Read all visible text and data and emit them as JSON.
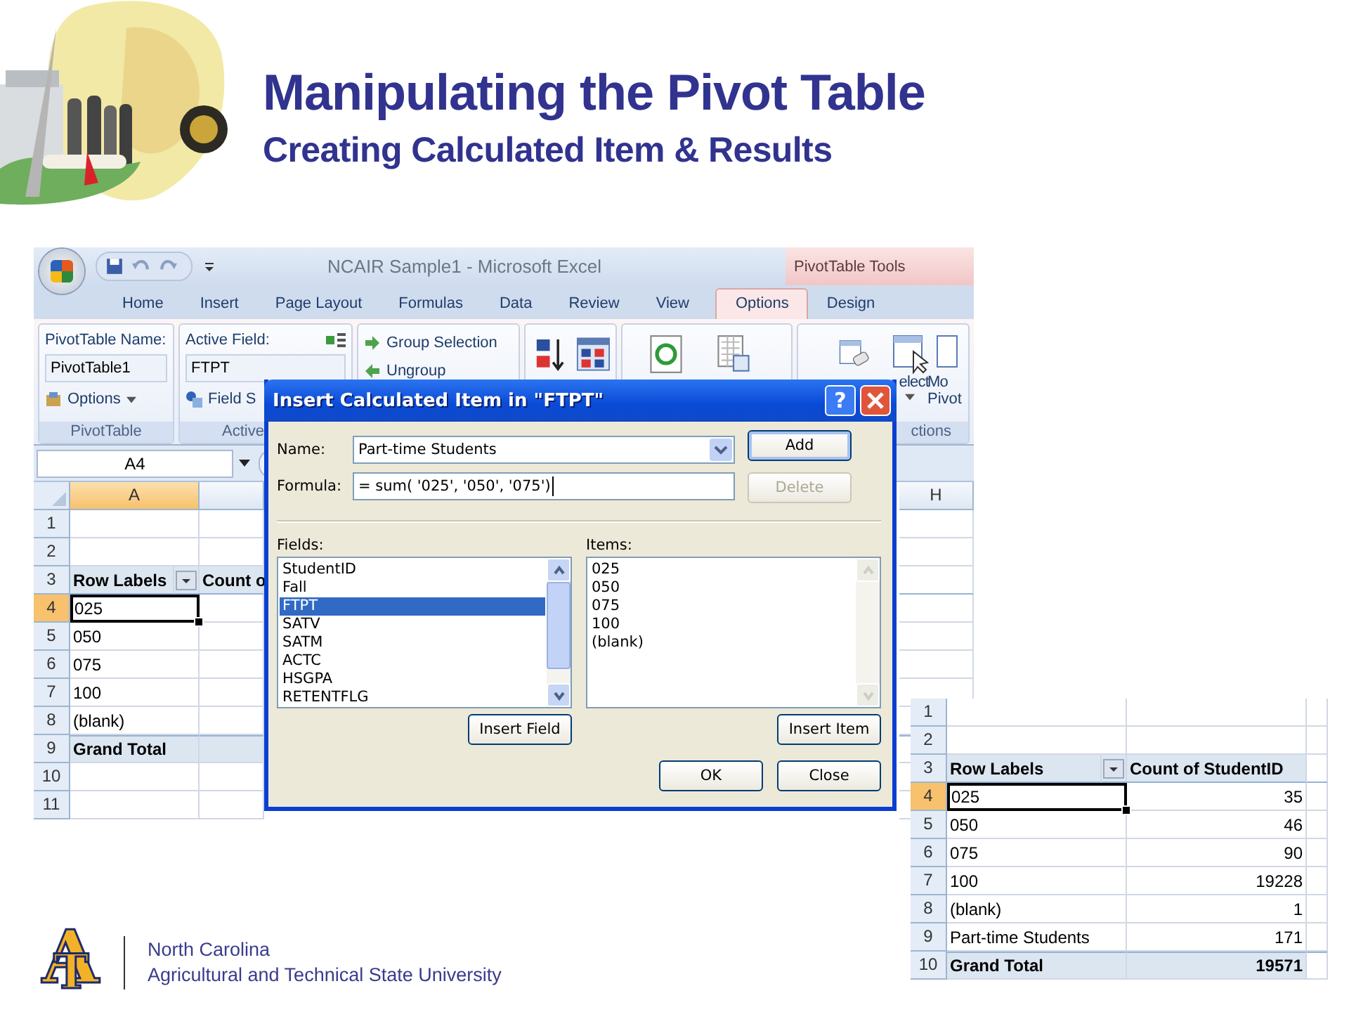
{
  "slide": {
    "title": "Manipulating the Pivot Table",
    "subtitle": "Creating Calculated Item & Results",
    "logo": {
      "letter_1": "A",
      "letter_2": "T"
    },
    "footer": [
      "North Carolina",
      "Agricultural and Technical State University"
    ]
  },
  "excel": {
    "title": "NCAIR Sample1 - Microsoft Excel",
    "contextual_tab": "PivotTable Tools",
    "tabs": [
      {
        "label": "Home",
        "selected": false
      },
      {
        "label": "Insert",
        "selected": false
      },
      {
        "label": "Page Layout",
        "selected": false
      },
      {
        "label": "Formulas",
        "selected": false
      },
      {
        "label": "Data",
        "selected": false
      },
      {
        "label": "Review",
        "selected": false
      },
      {
        "label": "View",
        "selected": false
      },
      {
        "label": "Options",
        "selected": true
      },
      {
        "label": "Design",
        "selected": false
      }
    ],
    "ribbon": {
      "pivot_name_label": "PivotTable Name:",
      "pivot_name": "PivotTable1",
      "options": "Options",
      "group_1": "PivotTable",
      "active_field_label": "Active Field:",
      "active_field": "FTPT",
      "field_settings": "Field S",
      "group_2": "Active",
      "group_selection": "Group Selection",
      "ungroup": "Ungroup",
      "select_fragment": "elect",
      "move_fragment_1": "Mo",
      "move_fragment_2": "Pivot",
      "group_6": "ctions"
    },
    "name_box": "A4",
    "columns": [
      {
        "label": "A",
        "selected": true
      },
      {
        "label": "H",
        "selected": false
      }
    ],
    "rows": [
      {
        "num": "1",
        "selected": false
      },
      {
        "num": "2",
        "selected": false
      },
      {
        "num": "3",
        "kind": "header",
        "a": "Row Labels",
        "b": "Count o",
        "selected": false
      },
      {
        "num": "4",
        "a": "025",
        "selected": true
      },
      {
        "num": "5",
        "a": "050",
        "selected": false
      },
      {
        "num": "6",
        "a": "075",
        "selected": false
      },
      {
        "num": "7",
        "a": "100",
        "selected": false
      },
      {
        "num": "8",
        "a": "(blank)",
        "selected": false
      },
      {
        "num": "9",
        "kind": "total",
        "a": "Grand Total",
        "selected": false
      },
      {
        "num": "10",
        "selected": false
      },
      {
        "num": "11",
        "selected": false
      }
    ]
  },
  "dialog": {
    "title": "Insert Calculated Item in \"FTPT\"",
    "help": "?",
    "name_label": "Name:",
    "name_value": "Part-time Students",
    "formula_label": "Formula:",
    "formula_value": "= sum( '025', '050', '075')",
    "add": "Add",
    "delete": "Delete",
    "delete_disabled": true,
    "fields_label": "Fields:",
    "fields": [
      {
        "label": "StudentID",
        "selected": false
      },
      {
        "label": "Fall",
        "selected": false
      },
      {
        "label": "FTPT",
        "selected": true
      },
      {
        "label": "SATV",
        "selected": false
      },
      {
        "label": "SATM",
        "selected": false
      },
      {
        "label": "ACTC",
        "selected": false
      },
      {
        "label": "HSGPA",
        "selected": false
      },
      {
        "label": "RETENTFLG",
        "selected": false
      }
    ],
    "items_label": "Items:",
    "items": [
      "025",
      "050",
      "075",
      "100",
      "(blank)"
    ],
    "insert_field": "Insert Field",
    "insert_item": "Insert Item",
    "ok": "OK",
    "close": "Close"
  },
  "results": {
    "rows": [
      {
        "num": "1",
        "selected": false
      },
      {
        "num": "2",
        "selected": false
      },
      {
        "num": "3",
        "kind": "header",
        "a": "Row Labels",
        "b": "Count of StudentID",
        "selected": false
      },
      {
        "num": "4",
        "a": "025",
        "b": "35",
        "selected": true
      },
      {
        "num": "5",
        "a": "050",
        "b": "46",
        "selected": false
      },
      {
        "num": "6",
        "a": "075",
        "b": "90",
        "selected": false
      },
      {
        "num": "7",
        "a": "100",
        "b": "19228",
        "selected": false
      },
      {
        "num": "8",
        "a": "(blank)",
        "b": "1",
        "selected": false
      },
      {
        "num": "9",
        "a": "Part-time Students",
        "b": "171",
        "selected": false
      },
      {
        "num": "10",
        "kind": "total",
        "a": "Grand Total",
        "b": "19571",
        "selected": false
      }
    ]
  }
}
